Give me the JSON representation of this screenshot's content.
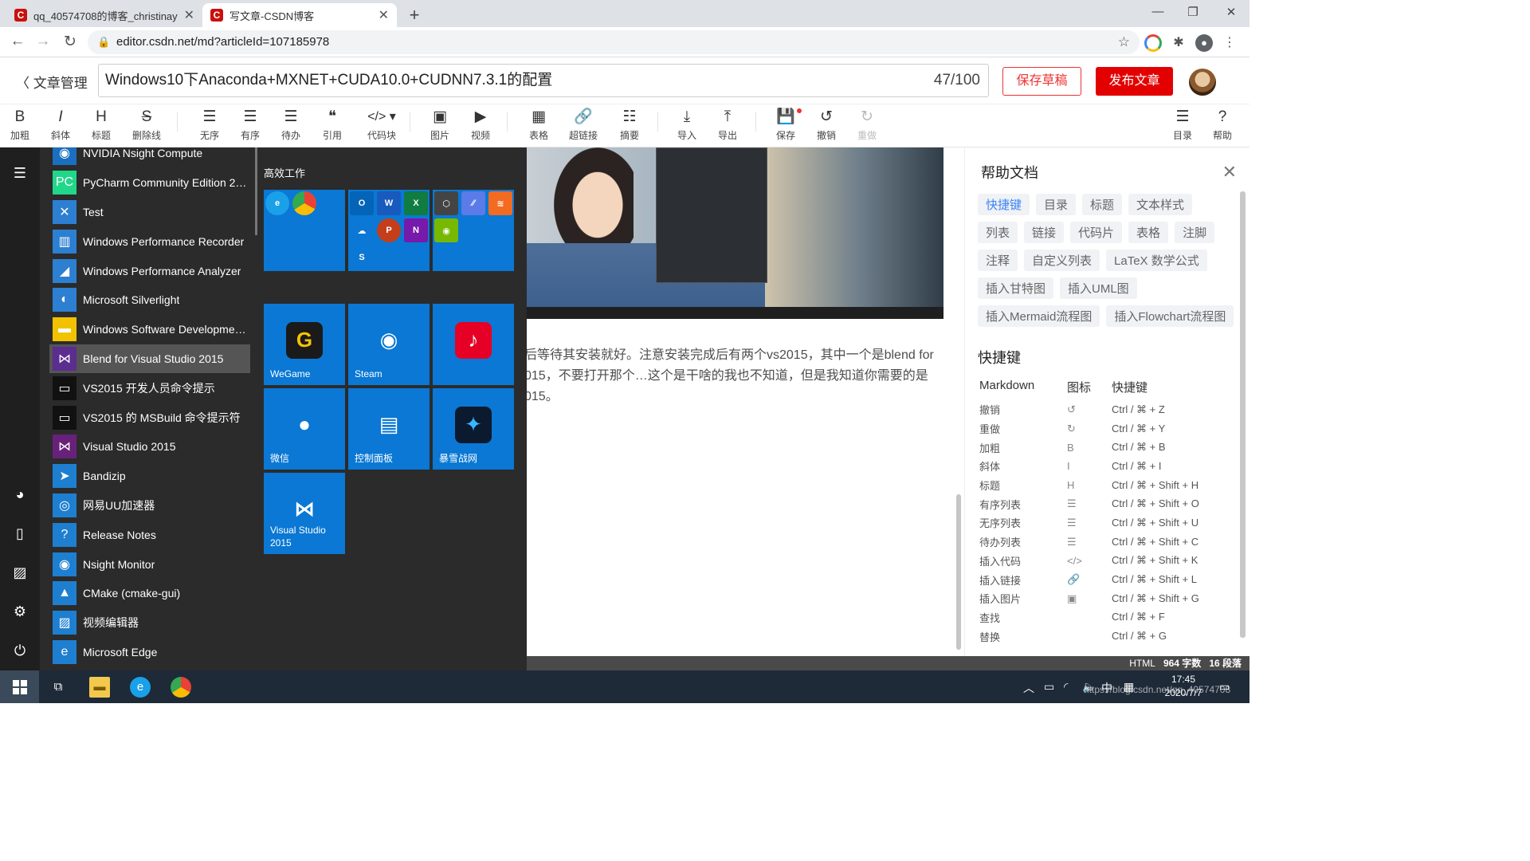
{
  "browser": {
    "tabs": [
      {
        "title": "qq_40574708的博客_christinay",
        "favicon": "C"
      },
      {
        "title": "写文章-CSDN博客",
        "favicon": "C"
      }
    ],
    "new_tab": "+",
    "url": "editor.csdn.net/md?articleId=107185978"
  },
  "editor_header": {
    "back_label": "文章管理",
    "title": "Windows10下Anaconda+MXNET+CUDA10.0+CUDNN7.3.1的配置",
    "title_count": "47/100",
    "save_draft": "保存草稿",
    "publish": "发布文章"
  },
  "toolbar": {
    "bold": "加粗",
    "italic": "斜体",
    "heading": "标题",
    "strike": "删除线",
    "ul": "无序",
    "ol": "有序",
    "todo": "待办",
    "quote": "引用",
    "code": "代码块",
    "image": "图片",
    "video": "视频",
    "table": "表格",
    "link": "超链接",
    "summary": "摘要",
    "import": "导入",
    "export": "导出",
    "save": "保存",
    "undo": "撤销",
    "redo": "重做",
    "toc": "目录",
    "help": "帮助"
  },
  "editor_text": {
    "line1": "后等待其安装就好。注意安装完成后有两个vs2015，其中一个是blend for",
    "line2": "015，不要打开那个…这个是干啥的我也不知道，但是我知道你需要的是",
    "line3": "015。"
  },
  "help_panel": {
    "title": "帮助文档",
    "chips": [
      "快捷键",
      "目录",
      "标题",
      "文本样式",
      "列表",
      "链接",
      "代码片",
      "表格",
      "注脚",
      "注释",
      "自定义列表",
      "LaTeX 数学公式",
      "插入甘特图",
      "插入UML图",
      "插入Mermaid流程图",
      "插入Flowchart流程图"
    ],
    "shortcuts_title": "快捷键",
    "columns": [
      "Markdown",
      "图标",
      "快捷键"
    ],
    "rows": [
      {
        "name": "撤销",
        "icon": "↺",
        "keys": "Ctrl / ⌘ + Z"
      },
      {
        "name": "重做",
        "icon": "↻",
        "keys": "Ctrl / ⌘ + Y"
      },
      {
        "name": "加粗",
        "icon": "B",
        "keys": "Ctrl / ⌘ + B"
      },
      {
        "name": "斜体",
        "icon": "I",
        "keys": "Ctrl / ⌘ + I"
      },
      {
        "name": "标题",
        "icon": "H",
        "keys": "Ctrl / ⌘ + Shift + H"
      },
      {
        "name": "有序列表",
        "icon": "☰",
        "keys": "Ctrl / ⌘ + Shift + O"
      },
      {
        "name": "无序列表",
        "icon": "☰",
        "keys": "Ctrl / ⌘ + Shift + U"
      },
      {
        "name": "待办列表",
        "icon": "☰",
        "keys": "Ctrl / ⌘ + Shift + C"
      },
      {
        "name": "插入代码",
        "icon": "</>",
        "keys": "Ctrl / ⌘ + Shift + K"
      },
      {
        "name": "插入链接",
        "icon": "🔗",
        "keys": "Ctrl / ⌘ + Shift + L"
      },
      {
        "name": "插入图片",
        "icon": "▣",
        "keys": "Ctrl / ⌘ + Shift + G"
      },
      {
        "name": "查找",
        "icon": "",
        "keys": "Ctrl / ⌘ + F"
      },
      {
        "name": "替换",
        "icon": "",
        "keys": "Ctrl / ⌘ + G"
      }
    ]
  },
  "status": {
    "mode": "HTML",
    "chars": "964 字数",
    "paras": "16 段落"
  },
  "start_menu": {
    "apps": [
      {
        "name": "NVIDIA Nsight Compute",
        "color": "#1a6fbf",
        "icon": "◉"
      },
      {
        "name": "PyCharm Community Edition 202...",
        "color": "#21d789",
        "icon": "PC"
      },
      {
        "name": "Test",
        "color": "#2c7fd1",
        "icon": "✕"
      },
      {
        "name": "Windows Performance Recorder",
        "color": "#2c7fd1",
        "icon": "▥"
      },
      {
        "name": "Windows Performance Analyzer",
        "color": "#2c7fd1",
        "icon": "◢"
      },
      {
        "name": "Microsoft Silverlight",
        "color": "#2c7fd1",
        "icon": "◐"
      },
      {
        "name": "Windows Software Development...",
        "color": "#f2c200",
        "icon": "▬"
      },
      {
        "name": "Blend for Visual Studio 2015",
        "color": "#5b2d8e",
        "icon": "⋈"
      },
      {
        "name": "VS2015 开发人员命令提示",
        "color": "#111",
        "icon": "▭"
      },
      {
        "name": "VS2015 的 MSBuild 命令提示符",
        "color": "#111",
        "icon": "▭"
      },
      {
        "name": "Visual Studio 2015",
        "color": "#68217a",
        "icon": "⋈"
      },
      {
        "name": "Bandizip",
        "color": "#1e7fd1",
        "icon": "➤"
      },
      {
        "name": "网易UU加速器",
        "color": "#1e7fd1",
        "icon": "◎"
      },
      {
        "name": "Release Notes",
        "color": "#1e7fd1",
        "icon": "?"
      },
      {
        "name": "Nsight Monitor",
        "color": "#1e7fd1",
        "icon": "◉"
      },
      {
        "name": "CMake (cmake-gui)",
        "color": "#1e7fd1",
        "icon": "▲"
      },
      {
        "name": "视频编辑器",
        "color": "#1e7fd1",
        "icon": "▨"
      },
      {
        "name": "Microsoft Edge",
        "color": "#1e7fd1",
        "icon": "e"
      }
    ],
    "group_title": "高效工作",
    "tiles": [
      {
        "label": "WeGame",
        "icon": "G",
        "icon_bg": "#1a1a1a",
        "icon_fg": "#f5c400"
      },
      {
        "label": "Steam",
        "icon": "◉",
        "icon_bg": "#0a78d4",
        "icon_fg": "#fff"
      },
      {
        "label": "",
        "icon": "♪",
        "icon_bg": "#e60026",
        "icon_fg": "#fff"
      },
      {
        "label": "微信",
        "icon": "●",
        "icon_bg": "#0a78d4",
        "icon_fg": "#fff"
      },
      {
        "label": "控制面板",
        "icon": "▤",
        "icon_bg": "#0a78d4",
        "icon_fg": "#fff"
      },
      {
        "label": "暴雪战网",
        "icon": "✦",
        "icon_bg": "#0b1a2e",
        "icon_fg": "#38b6ff"
      },
      {
        "label": "Visual Studio 2015",
        "icon": "⋈",
        "icon_bg": "#0a78d4",
        "icon_fg": "#fff"
      }
    ]
  },
  "taskbar": {
    "time": "17:45",
    "date": "2020/7/7",
    "ime": "中",
    "watermark": "https://blog.csdn.net/qq_40574708"
  }
}
